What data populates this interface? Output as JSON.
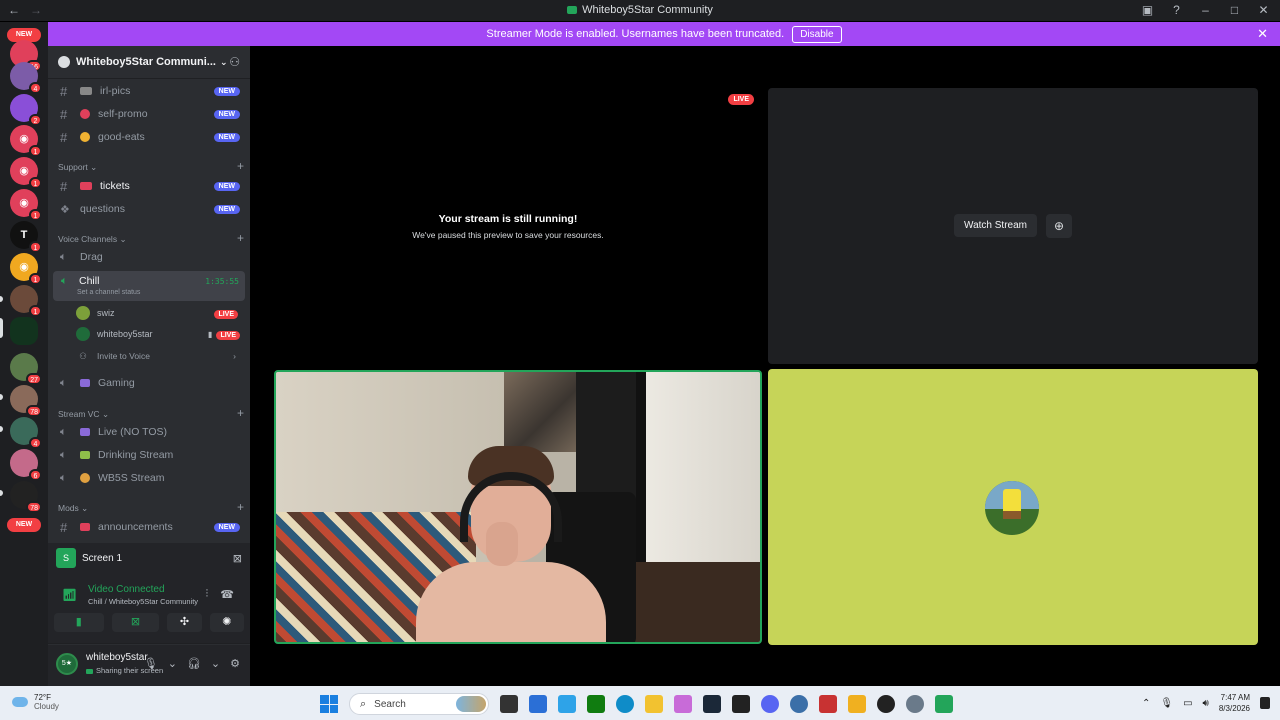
{
  "window": {
    "title": "Whiteboy5Star Community",
    "nav_back": "←",
    "nav_forward": "→"
  },
  "banner": {
    "text": "Streamer Mode is enabled. Usernames have been truncated.",
    "button": "Disable"
  },
  "rail": {
    "new_label": "NEW",
    "badges": [
      "16",
      "4",
      "2",
      "1",
      "1",
      "1",
      "1",
      "1",
      "1",
      "27",
      "78",
      "4",
      "6",
      "78"
    ],
    "t_glyph": "T"
  },
  "server": {
    "name": "Whiteboy5Star Communi..."
  },
  "channels": {
    "irl": "irl-pics",
    "selfpromo": "self-promo",
    "goodeats": "good-eats",
    "tickets": "tickets",
    "questions": "questions",
    "announcements": "announcements",
    "new": "NEW"
  },
  "categories": {
    "support": "Support",
    "voice": "Voice Channels",
    "streamvc": "Stream VC",
    "mods": "Mods"
  },
  "voice": {
    "drag": "Drag",
    "chill": "Chill",
    "chill_status": "Set a channel status",
    "chill_time": "1:35:55",
    "user1": "swiz",
    "user2": "whiteboy5star",
    "live": "LIVE",
    "invite": "Invite to Voice",
    "gaming": "Gaming",
    "livenotos": "Live (NO TOS)",
    "drinking": "Drinking Stream",
    "wb5s": "WB5S Stream"
  },
  "voicepanel": {
    "screen": "Screen 1",
    "connected": "Video Connected",
    "location": "Chill / Whiteboy5Star Community"
  },
  "user": {
    "name": "whiteboy5star",
    "status": "Sharing their screen"
  },
  "stage": {
    "live": "LIVE",
    "paused_title": "Your stream is still running!",
    "paused_sub": "We've paused this preview to save your resources.",
    "watch": "Watch Stream"
  },
  "taskbar": {
    "temp": "72°F",
    "cond": "Cloudy",
    "search": "Search",
    "time": "7:47 AM",
    "date": "8/3/2026"
  },
  "colors": {
    "accent": "#5865f2",
    "banner": "#a348f5",
    "green": "#23a55a",
    "red": "#f23f43",
    "tile_bg": "#c6d458"
  }
}
